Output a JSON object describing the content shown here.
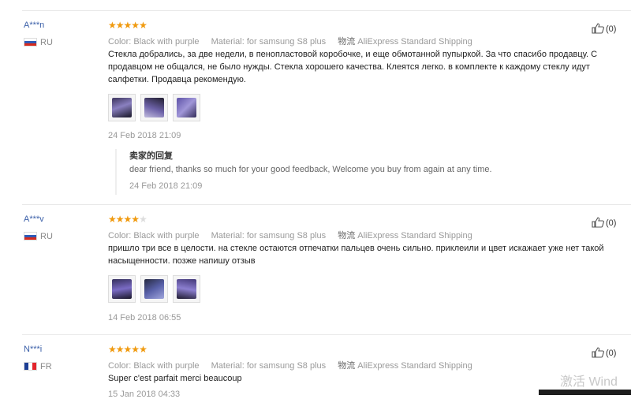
{
  "reviews": [
    {
      "user": "A***n",
      "country": "RU",
      "rating": 5,
      "stars": [
        "★",
        "★",
        "★",
        "★",
        "★"
      ],
      "color": "Color: Black with purple",
      "material": "Material: for samsung S8 plus",
      "ship_label": "物流",
      "ship_value": "AliExpress Standard Shipping",
      "useful_count": "(0)",
      "text": "Стекла добрались, за две недели, в пенопластовой коробочке, и еще обмотанной пупыркой. За что спасибо продавцу. С продавцом не общался, не было нужды. Стекла хорошего качества. Клеятся легко. в комплекте к каждому стеклу идут салфетки. Продавца рекомендую.",
      "date": "24 Feb 2018 21:09",
      "reply": {
        "title": "卖家的回复",
        "text": "dear friend, thanks so much for your good feedback, Welcome you buy from again at any time.",
        "date": "24 Feb 2018 21:09"
      }
    },
    {
      "user": "A***v",
      "country": "RU",
      "rating": 4,
      "stars": [
        "★",
        "★",
        "★",
        "★",
        "★"
      ],
      "color": "Color: Black with purple",
      "material": "Material: for samsung S8 plus",
      "ship_label": "物流",
      "ship_value": "AliExpress Standard Shipping",
      "useful_count": "(0)",
      "text": "пришло три все в целости. на стекле остаются отпечатки пальцев очень сильно. приклеили и цвет искажает уже нет такой насыщенности. позже напишу отзыв",
      "date": "14 Feb 2018 06:55"
    },
    {
      "user": "N***i",
      "country": "FR",
      "rating": 5,
      "stars": [
        "★",
        "★",
        "★",
        "★",
        "★"
      ],
      "color": "Color: Black with purple",
      "material": "Material: for samsung S8 plus",
      "ship_label": "物流",
      "ship_value": "AliExpress Standard Shipping",
      "useful_count": "(0)",
      "text": "Super c'est parfait merci beaucoup",
      "date": "15 Jan 2018 04:33"
    }
  ],
  "watermark": "激活 Wind"
}
